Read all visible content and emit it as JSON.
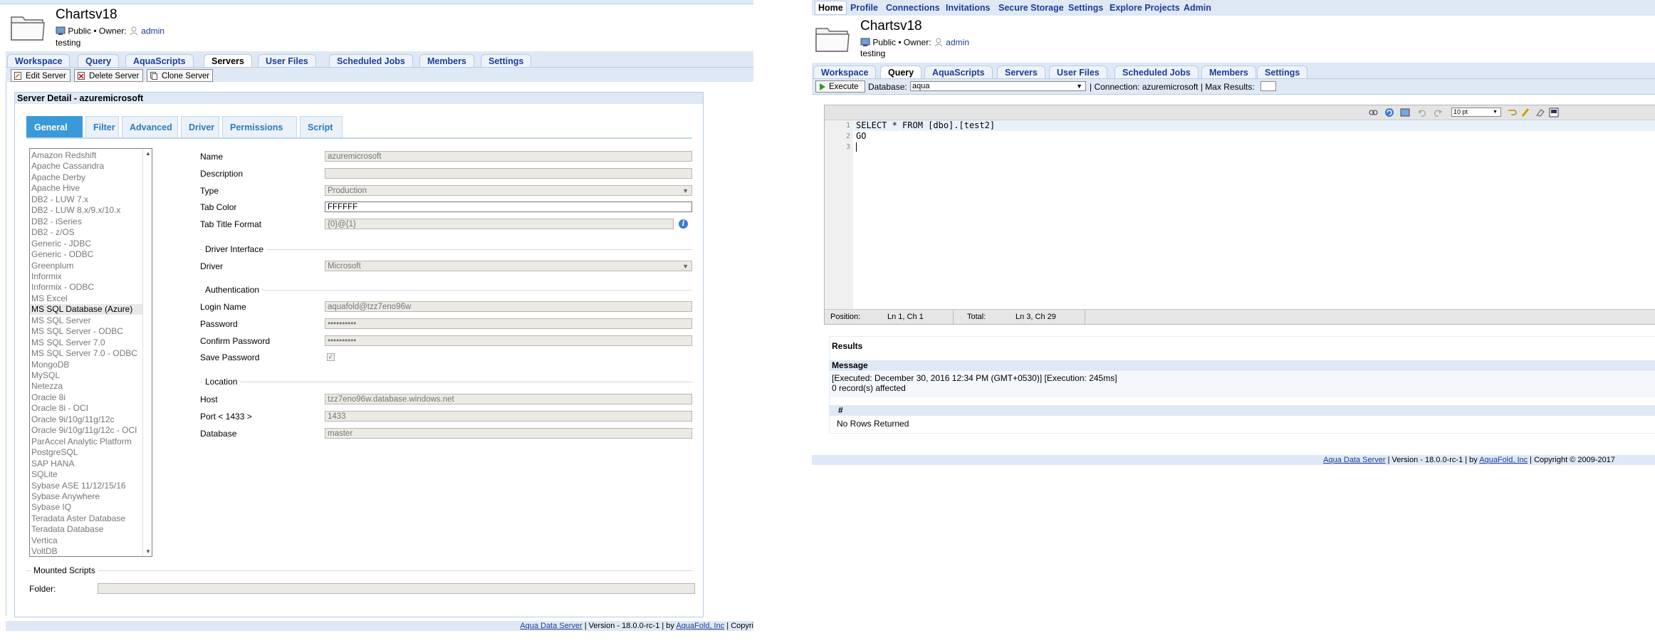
{
  "left": {
    "project": {
      "title": "Chartsv18",
      "visibility": "Public •",
      "owner_label": "Owner:",
      "owner_name": "admin",
      "description": "testing"
    },
    "tabs": [
      "Workspace",
      "Query",
      "AquaScripts",
      "Servers",
      "User Files",
      "Scheduled Jobs",
      "Members",
      "Settings"
    ],
    "active_tab": "Servers",
    "toolbar": {
      "edit_server": "Edit Server",
      "delete_server": "Delete Server",
      "clone_server": "Clone Server"
    },
    "server_detail": {
      "heading": "Server Detail - azuremicrosoft",
      "subtabs": [
        "General",
        "Filter",
        "Advanced",
        "Driver",
        "Permissions",
        "Script"
      ],
      "active_subtab": "General",
      "server_types": [
        "Amazon Redshift",
        "Apache Cassandra",
        "Apache Derby",
        "Apache Hive",
        "DB2 - LUW 7.x",
        "DB2 - LUW 8.x/9.x/10.x",
        "DB2 - iSeries",
        "DB2 - z/OS",
        "Generic - JDBC",
        "Generic - ODBC",
        "Greenplum",
        "Informix",
        "Informix - ODBC",
        "MS Excel",
        "MS SQL Database (Azure)",
        "MS SQL Server",
        "MS SQL Server - ODBC",
        "MS SQL Server 7.0",
        "MS SQL Server 7.0 - ODBC",
        "MongoDB",
        "MySQL",
        "Netezza",
        "Oracle 8i",
        "Oracle 8i - OCI",
        "Oracle 9i/10g/11g/12c",
        "Oracle 9i/10g/11g/12c - OCI",
        "ParAccel Analytic Platform",
        "PostgreSQL",
        "SAP HANA",
        "SQLite",
        "Sybase ASE 11/12/15/16",
        "Sybase Anywhere",
        "Sybase IQ",
        "Teradata Aster Database",
        "Teradata Database",
        "Vertica",
        "VoltDB"
      ],
      "selected_server_type": "MS SQL Database (Azure)",
      "general": {
        "name_label": "Name",
        "name_value": "azuremicrosoft",
        "description_label": "Description",
        "description_value": "",
        "type_label": "Type",
        "type_value": "Production",
        "tab_color_label": "Tab Color",
        "tab_color_value": "FFFFFF",
        "tab_title_label": "Tab Title Format",
        "tab_title_value": "{0}@{1}",
        "driver_interface_section": "Driver Interface",
        "driver_label": "Driver",
        "driver_value": "Microsoft",
        "authentication_section": "Authentication",
        "login_label": "Login Name",
        "login_value": "aquafold@tzz7eno96w",
        "password_label": "Password",
        "password_value": "••••••••••",
        "confirm_label": "Confirm Password",
        "confirm_value": "••••••••••",
        "save_password_label": "Save Password",
        "save_password_checked": true,
        "location_section": "Location",
        "host_label": "Host",
        "host_value": "tzz7eno96w.database.windows.net",
        "port_label": "Port < 1433 >",
        "port_value": "1433",
        "database_label": "Database",
        "database_value": "master"
      },
      "mounted_scripts_section": "Mounted Scripts",
      "folder_label": "Folder:",
      "folder_value": ""
    },
    "footer": {
      "link": "Aqua Data Server",
      "version": " | Version - 18.0.0-rc-1 | by ",
      "company": "AquaFold, Inc",
      "copyright": " | Copyri"
    }
  },
  "right": {
    "topnav": [
      "Home",
      "Profile",
      "Connections",
      "Invitations",
      "Secure Storage",
      "Settings",
      "Explore Projects",
      "Admin"
    ],
    "project": {
      "title": "Chartsv18",
      "visibility": "Public •",
      "owner_label": "Owner:",
      "owner_name": "admin",
      "description": "testing"
    },
    "tabs": [
      "Workspace",
      "Query",
      "AquaScripts",
      "Servers",
      "User Files",
      "Scheduled Jobs",
      "Members",
      "Settings"
    ],
    "active_tab": "Query",
    "query_toolbar": {
      "execute": "Execute",
      "database_label": "Database:",
      "database_value": "aqua",
      "connection_text": "| Connection: azuremicrosoft | Max Results:",
      "max_results_value": ""
    },
    "editor": {
      "font_size": "10 pt",
      "lines": [
        "SELECT * FROM [dbo].[test2]",
        "GO",
        ""
      ],
      "line_numbers": [
        "1",
        "2",
        "3"
      ],
      "position_label": "Position:",
      "position_value": "Ln 1, Ch 1",
      "total_label": "Total:",
      "total_value": "Ln 3, Ch 29"
    },
    "results": {
      "title": "Results",
      "message_header": "Message",
      "message_line1": "[Executed: December 30, 2016 12:34 PM (GMT+0530)] [Execution: 245ms]",
      "message_line2": "0 record(s) affected",
      "grid_header": "#",
      "empty_text": "No Rows Returned"
    },
    "footer": {
      "link": "Aqua Data Server",
      "version": " | Version - 18.0.0-rc-1 | by ",
      "company": "AquaFold, Inc",
      "copyright": " | Copyright © 2009-2017"
    }
  },
  "colors": {
    "tab_blue": "#1a3d9a",
    "header_bg": "#dfe9f5",
    "subtab_active": "#3a9ad9"
  }
}
